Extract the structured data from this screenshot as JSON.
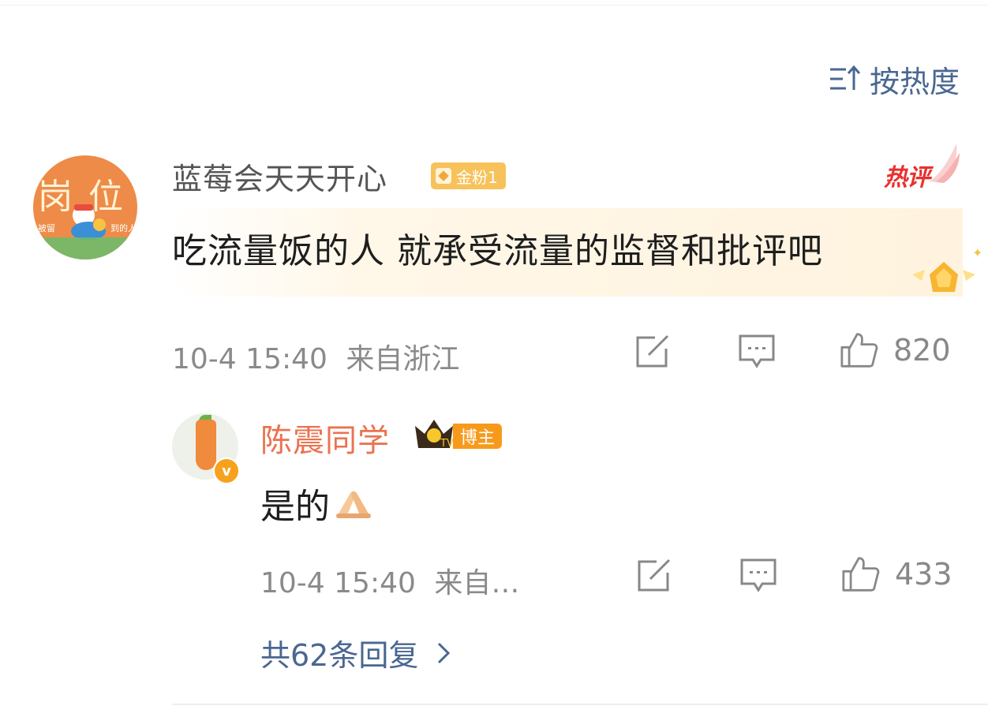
{
  "sort": {
    "label": "按热度",
    "icon": "sort-icon"
  },
  "comment": {
    "avatar_text": [
      "岗",
      "位"
    ],
    "avatar_small_text": [
      "被留",
      "到的人"
    ],
    "username": "蓝莓会天天开心",
    "fan_badge": "金粉1",
    "hot_label": "热评",
    "text": "吃流量饭的人 就承受流量的监督和批评吧",
    "time": "10-4 15:40",
    "location": "来自浙江",
    "likes": "820"
  },
  "reply": {
    "username": "陈震同学",
    "badge": "博主",
    "verified": "v",
    "text": "是的",
    "emoji": "pray-hands-emoji",
    "time": "10-4 15:40",
    "location": "来自…",
    "likes": "433"
  },
  "more_replies": "共62条回复",
  "colors": {
    "link_blue": "#4a6791",
    "username_orange": "#eb7350",
    "hot_red": "#e8312f",
    "badge_gold": "#f7c25a",
    "meta_gray": "#8a8a8a"
  }
}
